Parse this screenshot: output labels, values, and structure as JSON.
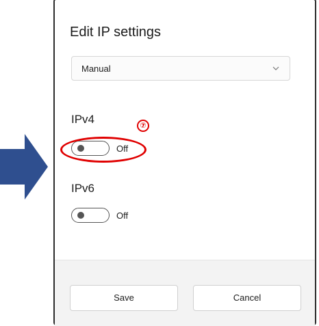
{
  "dialog": {
    "title": "Edit IP settings",
    "mode_select": {
      "value": "Manual"
    },
    "ipv4": {
      "label": "IPv4",
      "toggle_state": "Off",
      "annotation": "⑦"
    },
    "ipv6": {
      "label": "IPv6",
      "toggle_state": "Off"
    },
    "buttons": {
      "save": "Save",
      "cancel": "Cancel"
    }
  },
  "colors": {
    "arrow": "#2f4f8f",
    "highlight": "#e00000",
    "footer": "#f3f3f3",
    "border": "#2b2b2b"
  },
  "icons": {
    "arrow": "right-arrow-icon",
    "chevron": "chevron-down-icon"
  }
}
